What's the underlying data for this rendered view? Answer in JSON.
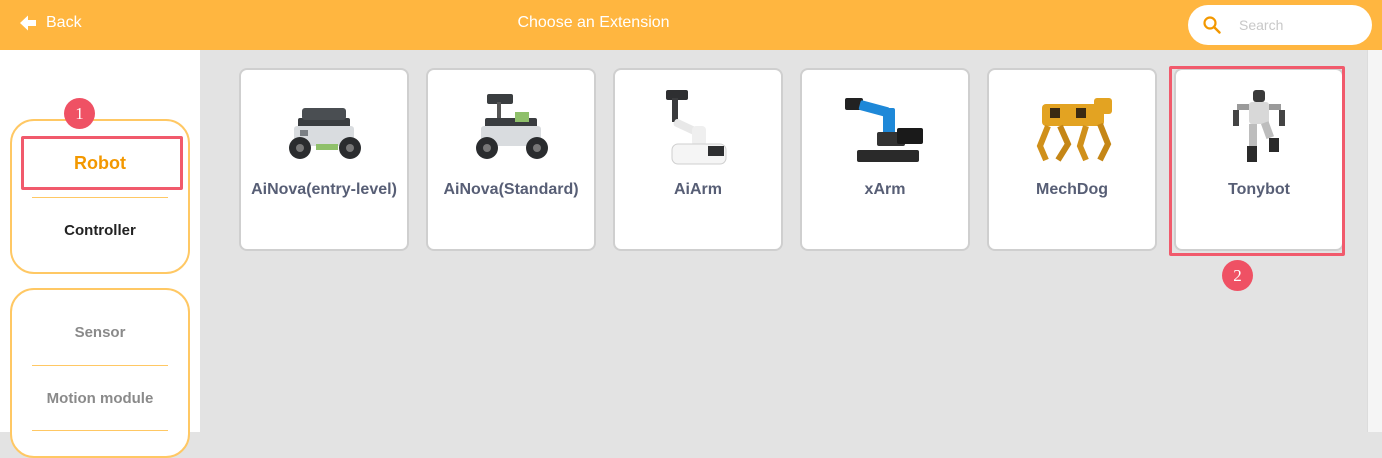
{
  "header": {
    "back_label": "Back",
    "title": "Choose an Extension",
    "search_placeholder": "Search"
  },
  "colors": {
    "header_bg": "#ffb640",
    "accent_orange": "#f39800",
    "annotation_red": "#ef5164",
    "card_text": "#575e75"
  },
  "sidebar": {
    "group1": [
      {
        "label": "Robot",
        "selected": true
      },
      {
        "label": "Controller",
        "selected": false
      }
    ],
    "group2": [
      {
        "label": "Sensor"
      },
      {
        "label": "Motion module"
      }
    ]
  },
  "extensions": [
    {
      "name": "AiNova(entry-level)",
      "icon": "robot-car-icon"
    },
    {
      "name": "AiNova(Standard)",
      "icon": "robot-car-camera-icon"
    },
    {
      "name": "AiArm",
      "icon": "robot-arm-icon"
    },
    {
      "name": "xArm",
      "icon": "blue-robot-arm-icon"
    },
    {
      "name": "MechDog",
      "icon": "robot-dog-icon"
    },
    {
      "name": "Tonybot",
      "icon": "humanoid-robot-icon"
    }
  ],
  "annotations": [
    {
      "number": "1"
    },
    {
      "number": "2"
    }
  ]
}
